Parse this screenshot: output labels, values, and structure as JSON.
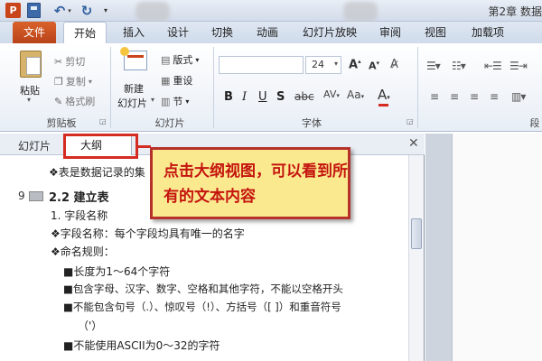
{
  "titlebar": {
    "app_icon": "P",
    "title": "第2章 数据"
  },
  "tabs": [
    "文件",
    "开始",
    "插入",
    "设计",
    "切换",
    "动画",
    "幻灯片放映",
    "审阅",
    "视图",
    "加载项"
  ],
  "ribbon": {
    "clipboard": {
      "paste": "粘贴",
      "cut": "剪切",
      "copy": "复制",
      "format_painter": "格式刷",
      "label": "剪贴板"
    },
    "slides": {
      "new_slide_line1": "新建",
      "new_slide_line2": "幻灯片",
      "layout": "版式",
      "reset": "重设",
      "section": "节",
      "label": "幻灯片"
    },
    "font": {
      "size": "24",
      "label": "字体"
    },
    "paragraph": {
      "label": "段"
    }
  },
  "panel": {
    "tab_slides": "幻灯片",
    "tab_outline": "大纲",
    "lines": {
      "l0": "❖表是数据记录的集",
      "num": "9",
      "heading": "2.2 建立表",
      "l2": "1. 字段名称",
      "l3": "❖字段名称：每个字段均具有唯一的名字",
      "l4": "❖命名规则：",
      "l5": "■长度为1～64个字符",
      "l6": "■包含字母、汉字、数字、空格和其他字符，不能以空格开头",
      "l7": "■不能包含句号（.）、惊叹号（!）、方括号（[ ]）和重音符号",
      "l8": "（'）",
      "l9": "■不能使用ASCII为0～32的字符"
    }
  },
  "callout": {
    "text": "点击大纲视图，可以看到所有的文本内容"
  },
  "colors": {
    "annotation_red": "#d42b22",
    "callout_bg": "#fbe98f",
    "file_tab": "#c9451c"
  }
}
